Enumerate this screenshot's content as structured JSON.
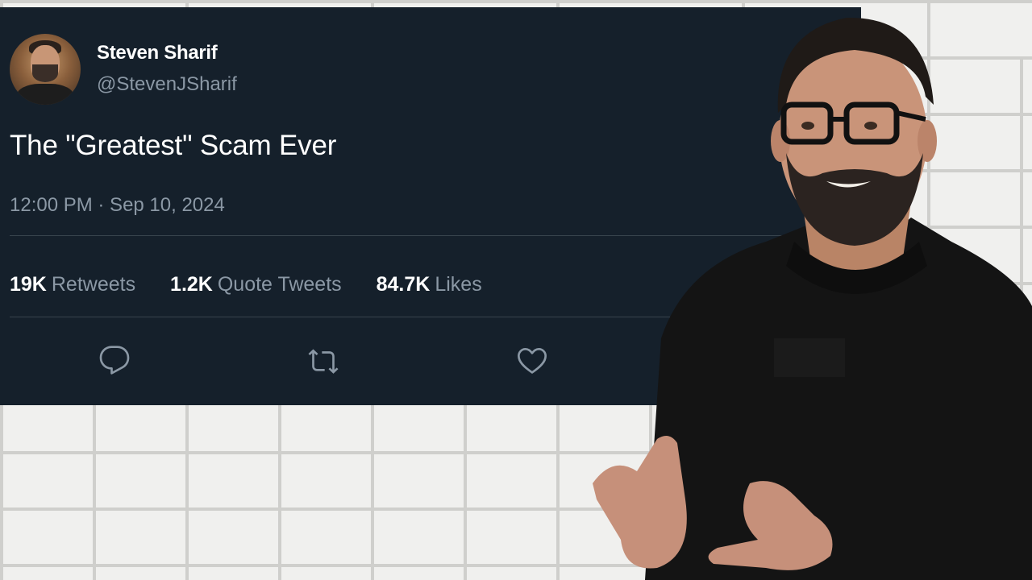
{
  "tweet": {
    "author": {
      "name": "Steven Sharif",
      "handle": "@StevenJSharif"
    },
    "text": "The \"Greatest\" Scam Ever",
    "timestamp": "12:00 PM · Sep 10, 2024",
    "stats": {
      "retweets_count": "19K",
      "retweets_label": "Retweets",
      "quotes_count": "1.2K",
      "quotes_label": "Quote Tweets",
      "likes_count": "84.7K",
      "likes_label": "Likes"
    },
    "actions": [
      "reply-icon",
      "retweet-icon",
      "like-icon"
    ]
  },
  "colors": {
    "card_background": "#15202b",
    "secondary_text": "#8b98a5",
    "divider": "#38444d"
  }
}
